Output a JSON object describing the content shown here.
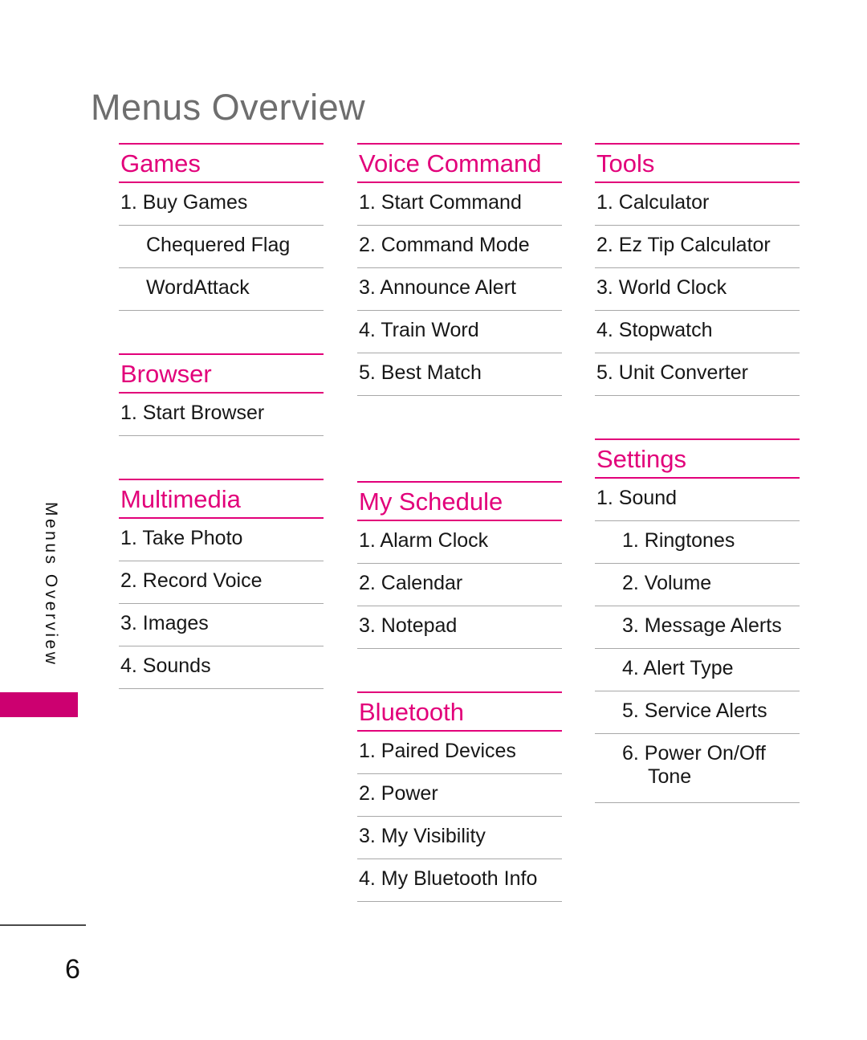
{
  "page": {
    "title": "Menus Overview",
    "side_tab_label": "Menus Overview",
    "page_number": "6",
    "accent_color": "#e2007a",
    "tab_color": "#cc0070",
    "title_color": "#6e6e6e",
    "rule_color": "#a8a8a8"
  },
  "columns": [
    {
      "sections": [
        {
          "heading": "Games",
          "items": [
            {
              "text": "1. Buy Games",
              "level": 1
            },
            {
              "text": "Chequered Flag",
              "level": 2
            },
            {
              "text": "WordAttack",
              "level": 2
            }
          ]
        },
        {
          "heading": "Browser",
          "items": [
            {
              "text": "1. Start Browser",
              "level": 1
            }
          ]
        },
        {
          "heading": "Multimedia",
          "items": [
            {
              "text": "1. Take Photo",
              "level": 1
            },
            {
              "text": "2. Record Voice",
              "level": 1
            },
            {
              "text": "3. Images",
              "level": 1
            },
            {
              "text": "4. Sounds",
              "level": 1
            }
          ]
        }
      ]
    },
    {
      "sections": [
        {
          "heading": "Voice Command",
          "items": [
            {
              "text": "1. Start Command",
              "level": 1
            },
            {
              "text": "2. Command Mode",
              "level": 1
            },
            {
              "text": "3. Announce Alert",
              "level": 1
            },
            {
              "text": "4. Train Word",
              "level": 1
            },
            {
              "text": "5. Best Match",
              "level": 1
            }
          ]
        },
        {
          "heading": "My Schedule",
          "items": [
            {
              "text": "1. Alarm Clock",
              "level": 1
            },
            {
              "text": "2. Calendar",
              "level": 1
            },
            {
              "text": "3. Notepad",
              "level": 1
            }
          ]
        },
        {
          "heading": "Bluetooth",
          "items": [
            {
              "text": "1. Paired Devices",
              "level": 1
            },
            {
              "text": "2. Power",
              "level": 1
            },
            {
              "text": "3. My Visibility",
              "level": 1
            },
            {
              "text": "4. My Bluetooth Info",
              "level": 1
            }
          ]
        }
      ]
    },
    {
      "sections": [
        {
          "heading": "Tools",
          "items": [
            {
              "text": "1. Calculator",
              "level": 1
            },
            {
              "text": "2. Ez Tip Calculator",
              "level": 1
            },
            {
              "text": "3. World Clock",
              "level": 1
            },
            {
              "text": "4. Stopwatch",
              "level": 1
            },
            {
              "text": "5. Unit Converter",
              "level": 1
            }
          ]
        },
        {
          "heading": "Settings",
          "items": [
            {
              "text": "1. Sound",
              "level": 1
            },
            {
              "text": "1. Ringtones",
              "level": 2
            },
            {
              "text": "2. Volume",
              "level": 2
            },
            {
              "text": "3. Message Alerts",
              "level": 2
            },
            {
              "text": "4. Alert Type",
              "level": 2
            },
            {
              "text": "5. Service Alerts",
              "level": 2
            },
            {
              "text": "6. Power On/Off",
              "text2": "Tone",
              "level": 2
            }
          ]
        }
      ]
    }
  ],
  "column_gaps": [
    [
      53,
      53
    ],
    [
      106,
      53
    ],
    [
      53
    ]
  ]
}
